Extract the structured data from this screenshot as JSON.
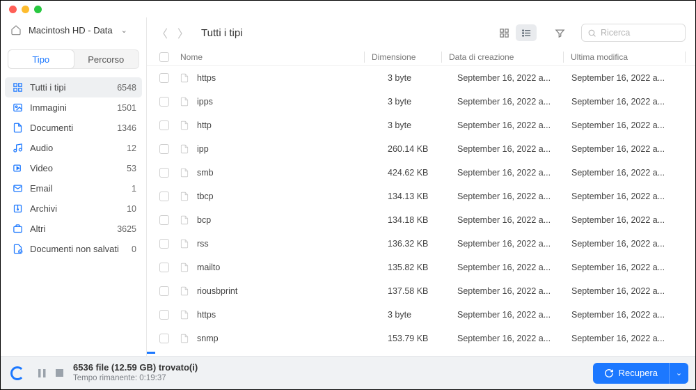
{
  "window": {
    "volume_name": "Macintosh HD - Data"
  },
  "sidebar": {
    "tabs": {
      "type": "Tipo",
      "path": "Percorso"
    },
    "categories": [
      {
        "key": "all",
        "label": "Tutti i tipi",
        "count": "6548",
        "active": true
      },
      {
        "key": "images",
        "label": "Immagini",
        "count": "1501"
      },
      {
        "key": "docs",
        "label": "Documenti",
        "count": "1346"
      },
      {
        "key": "audio",
        "label": "Audio",
        "count": "12"
      },
      {
        "key": "video",
        "label": "Video",
        "count": "53"
      },
      {
        "key": "email",
        "label": "Email",
        "count": "1"
      },
      {
        "key": "archives",
        "label": "Archivi",
        "count": "10"
      },
      {
        "key": "other",
        "label": "Altri",
        "count": "3625"
      },
      {
        "key": "unsaved",
        "label": "Documenti non salvati",
        "count": "0"
      }
    ]
  },
  "toolbar": {
    "breadcrumb": "Tutti i tipi",
    "search_placeholder": "Ricerca"
  },
  "columns": {
    "name": "Nome",
    "size": "Dimensione",
    "created": "Data di creazione",
    "modified": "Ultima modifica"
  },
  "files": [
    {
      "name": "https",
      "size": "3 byte",
      "created": "September 16, 2022 a...",
      "modified": "September 16, 2022 a..."
    },
    {
      "name": "ipps",
      "size": "3 byte",
      "created": "September 16, 2022 a...",
      "modified": "September 16, 2022 a..."
    },
    {
      "name": "http",
      "size": "3 byte",
      "created": "September 16, 2022 a...",
      "modified": "September 16, 2022 a..."
    },
    {
      "name": "ipp",
      "size": "260.14 KB",
      "created": "September 16, 2022 a...",
      "modified": "September 16, 2022 a..."
    },
    {
      "name": "smb",
      "size": "424.62 KB",
      "created": "September 16, 2022 a...",
      "modified": "September 16, 2022 a..."
    },
    {
      "name": "tbcp",
      "size": "134.13 KB",
      "created": "September 16, 2022 a...",
      "modified": "September 16, 2022 a..."
    },
    {
      "name": "bcp",
      "size": "134.18 KB",
      "created": "September 16, 2022 a...",
      "modified": "September 16, 2022 a..."
    },
    {
      "name": "rss",
      "size": "136.32 KB",
      "created": "September 16, 2022 a...",
      "modified": "September 16, 2022 a..."
    },
    {
      "name": "mailto",
      "size": "135.82 KB",
      "created": "September 16, 2022 a...",
      "modified": "September 16, 2022 a..."
    },
    {
      "name": "riousbprint",
      "size": "137.58 KB",
      "created": "September 16, 2022 a...",
      "modified": "September 16, 2022 a..."
    },
    {
      "name": "https",
      "size": "3 byte",
      "created": "September 16, 2022 a...",
      "modified": "September 16, 2022 a..."
    },
    {
      "name": "snmp",
      "size": "153.79 KB",
      "created": "September 16, 2022 a...",
      "modified": "September 16, 2022 a..."
    }
  ],
  "statusbar": {
    "found_line": "6536 file (12.59 GB) trovato(i)",
    "time_line": "Tempo rimanente: 0:19:37",
    "recover_label": "Recupera"
  }
}
